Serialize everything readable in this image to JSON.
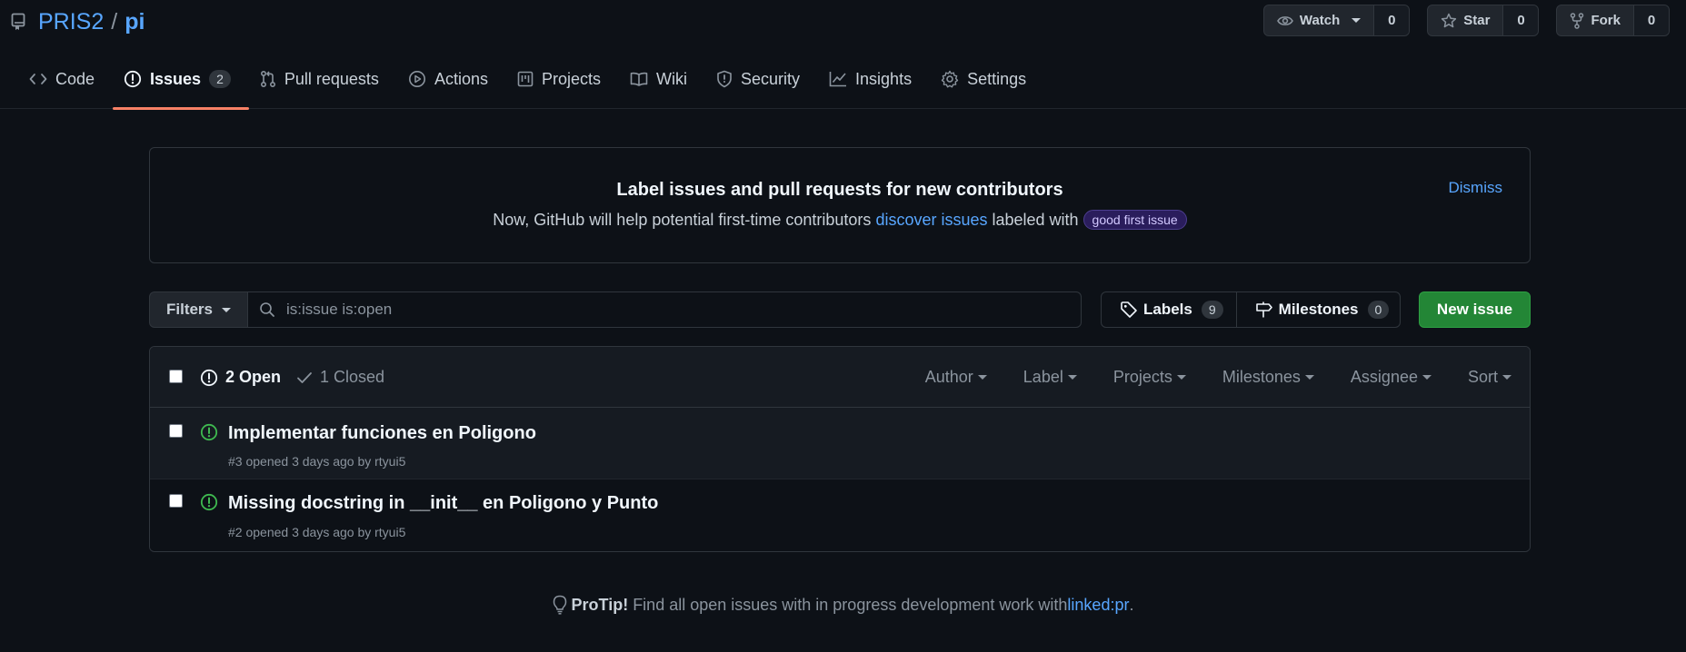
{
  "repo": {
    "owner": "PRIS2",
    "separator": "/",
    "name": "pi"
  },
  "actions": {
    "watch": {
      "label": "Watch",
      "count": "0"
    },
    "star": {
      "label": "Star",
      "count": "0"
    },
    "fork": {
      "label": "Fork",
      "count": "0"
    }
  },
  "tabs": [
    {
      "label": "Code",
      "icon": "code-icon"
    },
    {
      "label": "Issues",
      "icon": "issue-icon",
      "count": "2",
      "selected": true
    },
    {
      "label": "Pull requests",
      "icon": "pull-request-icon"
    },
    {
      "label": "Actions",
      "icon": "play-icon"
    },
    {
      "label": "Projects",
      "icon": "project-icon"
    },
    {
      "label": "Wiki",
      "icon": "book-icon"
    },
    {
      "label": "Security",
      "icon": "shield-icon"
    },
    {
      "label": "Insights",
      "icon": "graph-icon"
    },
    {
      "label": "Settings",
      "icon": "gear-icon"
    }
  ],
  "banner": {
    "title": "Label issues and pull requests for new contributors",
    "text_before": "Now, GitHub will help potential first-time contributors",
    "link": "discover issues",
    "text_after": "labeled with",
    "label_badge": "good first issue",
    "dismiss": "Dismiss"
  },
  "filters": {
    "button": "Filters",
    "search_value": "is:issue is:open",
    "labels": {
      "label": "Labels",
      "count": "9"
    },
    "milestones": {
      "label": "Milestones",
      "count": "0"
    },
    "new_issue": "New issue"
  },
  "list_header": {
    "open": "2 Open",
    "closed": "1 Closed",
    "filters": [
      "Author",
      "Label",
      "Projects",
      "Milestones",
      "Assignee",
      "Sort"
    ]
  },
  "issues": [
    {
      "title": "Implementar funciones en Poligono",
      "meta": "#3 opened 3 days ago by rtyui5"
    },
    {
      "title": "Missing docstring in __init__ en Poligono y Punto",
      "meta": "#2 opened 3 days ago by rtyui5"
    }
  ],
  "protip": {
    "bold": "ProTip!",
    "text": "Find all open issues with in progress development work with",
    "link": "linked:pr",
    "end": "."
  },
  "colors": {
    "background": "#0d1117",
    "link": "#58a6ff",
    "open_issue": "#3fb950",
    "primary_button": "#238636",
    "tab_underline": "#f78166"
  }
}
